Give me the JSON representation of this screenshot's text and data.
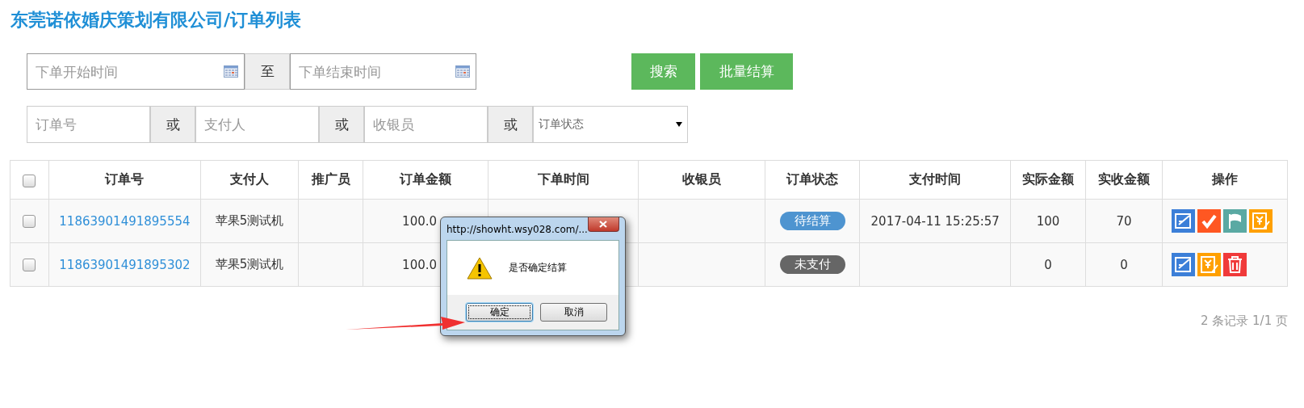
{
  "page_title": "东莞诺依婚庆策划有限公司/订单列表",
  "date_filter": {
    "start_placeholder": "下单开始时间",
    "separator": "至",
    "end_placeholder": "下单结束时间"
  },
  "buttons": [
    "搜索",
    "批量结算"
  ],
  "filters": [
    {
      "placeholder": "订单号",
      "joiner": "或"
    },
    {
      "placeholder": "支付人",
      "joiner": "或"
    },
    {
      "placeholder": "收银员",
      "joiner": "或"
    }
  ],
  "status_select": {
    "placeholder": "订单状态"
  },
  "table": {
    "select_all": {
      "checked": false
    },
    "columns": [
      "订单号",
      "支付人",
      "推广员",
      "订单金额",
      "下单时间",
      "收银员",
      "订单状态",
      "支付时间",
      "实际金额",
      "实收金额",
      "操作"
    ],
    "rows": [
      {
        "checked": false,
        "order_no": "11863901491895554",
        "payer": "苹果5测试机",
        "amount": "100.0",
        "status": {
          "label": "待结算",
          "color": "#4e94d0"
        },
        "pay_time": "2017-04-11 15:25:57",
        "actual": "100",
        "received": "70",
        "actions": [
          {
            "kind": "edit"
          },
          {
            "kind": "check"
          },
          {
            "kind": "flag"
          },
          {
            "kind": "bill"
          }
        ]
      },
      {
        "checked": false,
        "order_no": "11863901491895302",
        "payer": "苹果5测试机",
        "amount": "100.0",
        "status": {
          "label": "未支付",
          "color": "#666666"
        },
        "pay_time": "",
        "actual": "0",
        "received": "0",
        "actions": [
          {
            "kind": "edit"
          },
          {
            "kind": "bill"
          },
          {
            "kind": "delete"
          }
        ]
      }
    ]
  },
  "pagination": "2 条记录 1/1 页",
  "dialog": {
    "title": "http://showht.wsy028.com/...",
    "message": "是否确定结算",
    "buttons": [
      {
        "label": "确定",
        "selected": true
      },
      {
        "label": "取消",
        "selected": false
      }
    ]
  }
}
